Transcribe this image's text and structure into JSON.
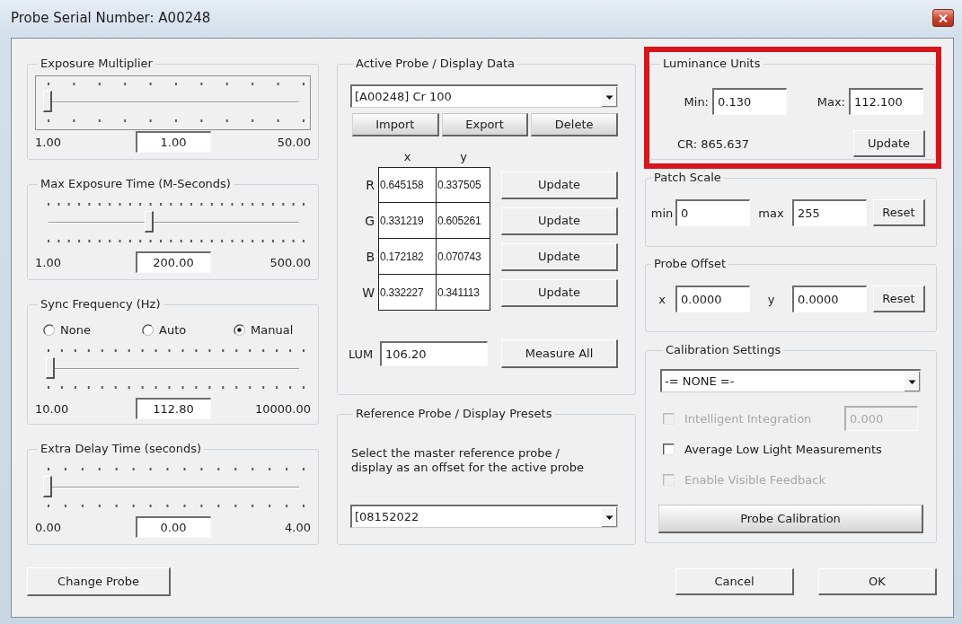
{
  "window": {
    "title": "Probe Serial Number: A00248"
  },
  "slider_groups": [
    {
      "title": "Exposure Multiplier",
      "focused": true,
      "level": 0,
      "min": "1.00",
      "value": "1.00",
      "max": "50.00"
    },
    {
      "title": "Max Exposure Time (M-Seconds)",
      "focused": false,
      "level": 0.4,
      "min": "1.00",
      "value": "200.00",
      "max": "500.00"
    },
    {
      "title": "Sync Frequency (Hz)",
      "focused": false,
      "options": [
        {
          "label": "None",
          "selected": false
        },
        {
          "label": "Auto",
          "selected": false
        },
        {
          "label": "Manual",
          "selected": true
        }
      ],
      "level": 0.01,
      "min": "10.00",
      "value": "112.80",
      "max": "10000.00"
    },
    {
      "title": "Extra Delay Time (seconds)",
      "focused": false,
      "level": 0,
      "min": "0.00",
      "value": "0.00",
      "max": "4.00"
    }
  ],
  "change_probe_button": "Change Probe",
  "active_probe": {
    "title": "Active Probe / Display Data",
    "probe": "[A00248] Cr 100",
    "actions": [
      "Import",
      "Export",
      "Delete"
    ],
    "columns": [
      "x",
      "y"
    ],
    "rows": [
      {
        "label": "R",
        "values": [
          "0.645158",
          "0.337505"
        ],
        "button": "Update"
      },
      {
        "label": "G",
        "values": [
          "0.331219",
          "0.605261"
        ],
        "button": "Update"
      },
      {
        "label": "B",
        "values": [
          "0.172182",
          "0.070743"
        ],
        "button": "Update"
      },
      {
        "label": "W",
        "values": [
          "0.332227",
          "0.341113"
        ],
        "button": "Update"
      }
    ],
    "lum": {
      "label": "LUM",
      "value": "106.20",
      "button": "Measure All"
    }
  },
  "reference": {
    "title": "Reference Probe / Display Presets",
    "description": "Select the master reference probe / display as an offset for the active probe",
    "preset": "[08152022"
  },
  "luminance_units": {
    "title": "Luminance Units",
    "highlighted": true,
    "fields": [
      {
        "label": "Min:",
        "value": "0.130"
      },
      {
        "label": "Max:",
        "value": "112.100"
      }
    ],
    "contrast_ratio": "CR: 865.637",
    "button": "Update"
  },
  "patch_scale": {
    "title": "Patch Scale",
    "fields": [
      {
        "label": "min",
        "value": "0"
      },
      {
        "label": "max",
        "value": "255"
      }
    ],
    "button": "Reset"
  },
  "probe_offset": {
    "title": "Probe Offset",
    "fields": [
      {
        "label": "x",
        "value": "0.0000"
      },
      {
        "label": "y",
        "value": "0.0000"
      }
    ],
    "button": "Reset"
  },
  "calibration_settings": {
    "title": "Calibration Settings",
    "selection": "-= NONE =-",
    "options": [
      {
        "label": "Intelligent Integration",
        "checked": false,
        "disabled": true,
        "value": "0.000"
      },
      {
        "label": "Average Low Light Measurements",
        "checked": false,
        "disabled": false
      },
      {
        "label": "Enable Visible Feedback",
        "checked": false,
        "disabled": true
      }
    ],
    "button": "Probe Calibration"
  },
  "dialog_buttons": [
    "Cancel",
    "OK"
  ]
}
